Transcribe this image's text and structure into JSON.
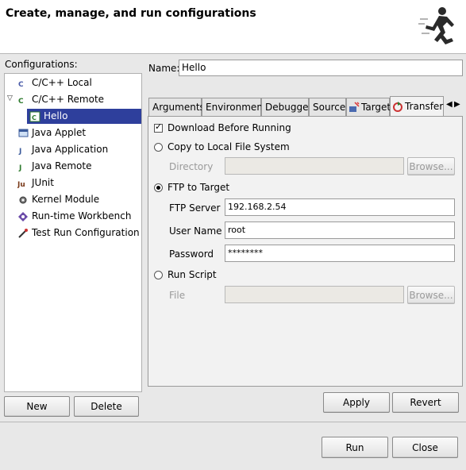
{
  "header": {
    "title": "Create, manage, and run configurations",
    "icon": "running-man-icon"
  },
  "configurations": {
    "label": "Configurations:",
    "items": [
      {
        "label": "C/C++ Local",
        "icon": "cpp-local-icon"
      },
      {
        "label": "C/C++ Remote",
        "icon": "cpp-remote-icon",
        "expanded": true
      },
      {
        "label": "Hello",
        "icon": "launch-config-icon",
        "selected": true
      },
      {
        "label": "Java Applet",
        "icon": "java-applet-icon"
      },
      {
        "label": "Java Application",
        "icon": "java-application-icon"
      },
      {
        "label": "Java Remote",
        "icon": "java-remote-icon"
      },
      {
        "label": "JUnit",
        "icon": "junit-icon"
      },
      {
        "label": "Kernel Module",
        "icon": "kernel-module-icon"
      },
      {
        "label": "Run-time Workbench",
        "icon": "runtime-workbench-icon"
      },
      {
        "label": "Test Run Configuration",
        "icon": "test-run-icon"
      }
    ],
    "new_label": "New",
    "delete_label": "Delete"
  },
  "name": {
    "label": "Name:",
    "value": "Hello"
  },
  "tabs": [
    {
      "label": "Arguments"
    },
    {
      "label": "Environment"
    },
    {
      "label": "Debugger"
    },
    {
      "label": "Source"
    },
    {
      "label": "Target",
      "icon": "target-icon"
    },
    {
      "label": "Transfer",
      "icon": "transfer-icon",
      "active": true
    }
  ],
  "transfer": {
    "download_label": "Download Before Running",
    "download_checked": true,
    "copy_label": "Copy to Local File System",
    "directory_label": "Directory",
    "directory_value": "",
    "browse_label": "Browse...",
    "ftp_label": "FTP to Target",
    "ftp_selected": true,
    "ftp_server_label": "FTP Server",
    "ftp_server_value": "192.168.2.54",
    "user_name_label": "User Name",
    "user_name_value": "root",
    "password_label": "Password",
    "password_value": "********",
    "run_script_label": "Run Script",
    "file_label": "File",
    "file_value": "",
    "browse2_label": "Browse..."
  },
  "actions": {
    "apply_label": "Apply",
    "revert_label": "Revert",
    "run_label": "Run",
    "close_label": "Close"
  }
}
